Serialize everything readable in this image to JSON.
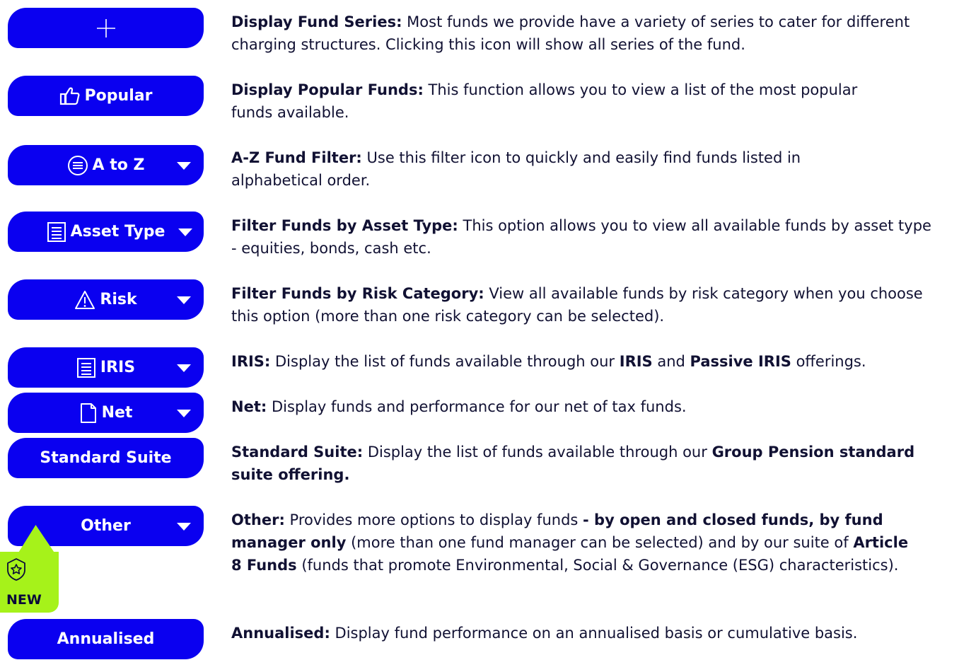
{
  "buttons": {
    "series": {
      "label": ""
    },
    "popular": {
      "label": "Popular"
    },
    "atoz": {
      "label": "A to Z"
    },
    "asset": {
      "label": "Asset Type"
    },
    "risk": {
      "label": "Risk"
    },
    "iris": {
      "label": "IRIS"
    },
    "net": {
      "label": "Net"
    },
    "standard": {
      "label": "Standard Suite"
    },
    "other": {
      "label": "Other"
    },
    "annualised": {
      "label": "Annualised"
    }
  },
  "badge": {
    "label": "NEW"
  },
  "descriptions": {
    "series": {
      "title": "Display Fund Series:",
      "text": " Most funds we provide have a variety of series to cater for different charging structures. Clicking this icon will show all series of the fund."
    },
    "popular": {
      "title": "Display Popular Funds:",
      "text": " This function allows you to view a list of the most popular funds available."
    },
    "atoz": {
      "title": "A-Z Fund Filter:",
      "text": " Use this filter icon to quickly and easily find funds listed in alphabetical order."
    },
    "asset": {
      "title": "Filter Funds by Asset Type:",
      "text": " This option allows you to view all available funds by asset type - equities, bonds, cash etc."
    },
    "risk": {
      "title": "Filter Funds by Risk Category:",
      "text": " View all available funds by risk category when you choose this option (more than one risk category can be selected)."
    },
    "iris": {
      "title": "IRIS:",
      "text1": " Display the list of funds available through our ",
      "bold1": "IRIS",
      "text2": " and ",
      "bold2": "Passive IRIS",
      "text3": " offerings."
    },
    "net": {
      "title": "Net:",
      "text": " Display funds and performance for our net of tax funds."
    },
    "standard": {
      "title": "Standard Suite:",
      "text": " Display the list of funds available through our ",
      "bold": "Group Pension standard suite offering."
    },
    "other": {
      "title": "Other:",
      "text1": " Provides more options to display funds ",
      "bold1": "- by open and closed funds, by fund manager only",
      "text2": " (more than one fund manager can be selected) and by our suite of ",
      "bold2": "Article 8 Funds",
      "text3": " (funds that promote Environmental, Social & Governance (ESG) characteristics)."
    },
    "annualised": {
      "title": "Annualised:",
      "text": " Display fund performance on an annualised basis or cumulative basis."
    }
  },
  "colors": {
    "button_bg": "#0a00f0",
    "badge_bg": "#a6f21a",
    "text": "#111133"
  }
}
